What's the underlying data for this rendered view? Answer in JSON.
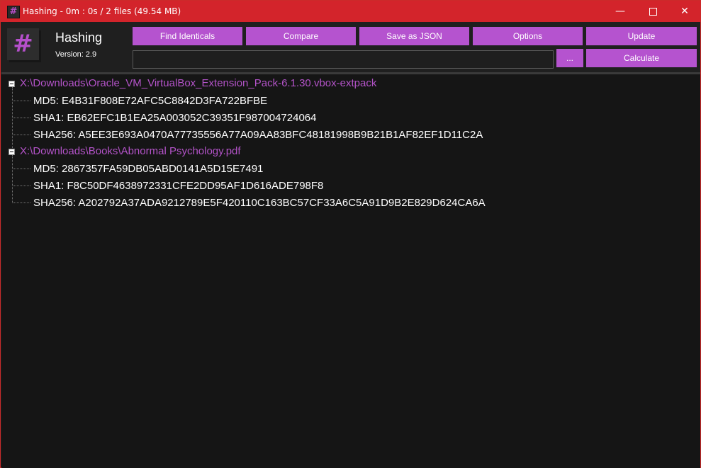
{
  "titlebar": {
    "title": "Hashing - 0m : 0s / 2 files (49.54 MB)",
    "icon": "hash-icon",
    "minimize": "—",
    "close": "✕"
  },
  "header": {
    "app_name": "Hashing",
    "version": "Version: 2.9"
  },
  "toolbar": {
    "find_identicals": "Find Identicals",
    "compare": "Compare",
    "save_json": "Save as JSON",
    "options": "Options",
    "update": "Update",
    "browse": "...",
    "calculate": "Calculate"
  },
  "path_input": {
    "value": "",
    "placeholder": ""
  },
  "tree": {
    "files": [
      {
        "path": "X:\\Downloads\\Oracle_VM_VirtualBox_Extension_Pack-6.1.30.vbox-extpack",
        "md5": "MD5: E4B31F808E72AFC5C8842D3FA722BFBE",
        "sha1": "SHA1: EB62EFC1B1EA25A003052C39351F987004724064",
        "sha256": "SHA256: A5EE3E693A0470A77735556A77A09AA83BFC48181998B9B21B1AF82EF1D11C2A"
      },
      {
        "path": "X:\\Downloads\\Books\\Abnormal Psychology.pdf",
        "md5": "MD5: 2867357FA59DB05ABD0141A5D15E7491",
        "sha1": "SHA1: F8C50DF4638972331CFE2DD95AF1D616ADE798F8",
        "sha256": "SHA256: A202792A37ADA9212789E5F420110C163BC57CF33A6C5A91D9B2E829D624CA6A"
      }
    ]
  },
  "colors": {
    "titlebar": "#d3242b",
    "accent": "#b553cf",
    "background": "#151515"
  }
}
